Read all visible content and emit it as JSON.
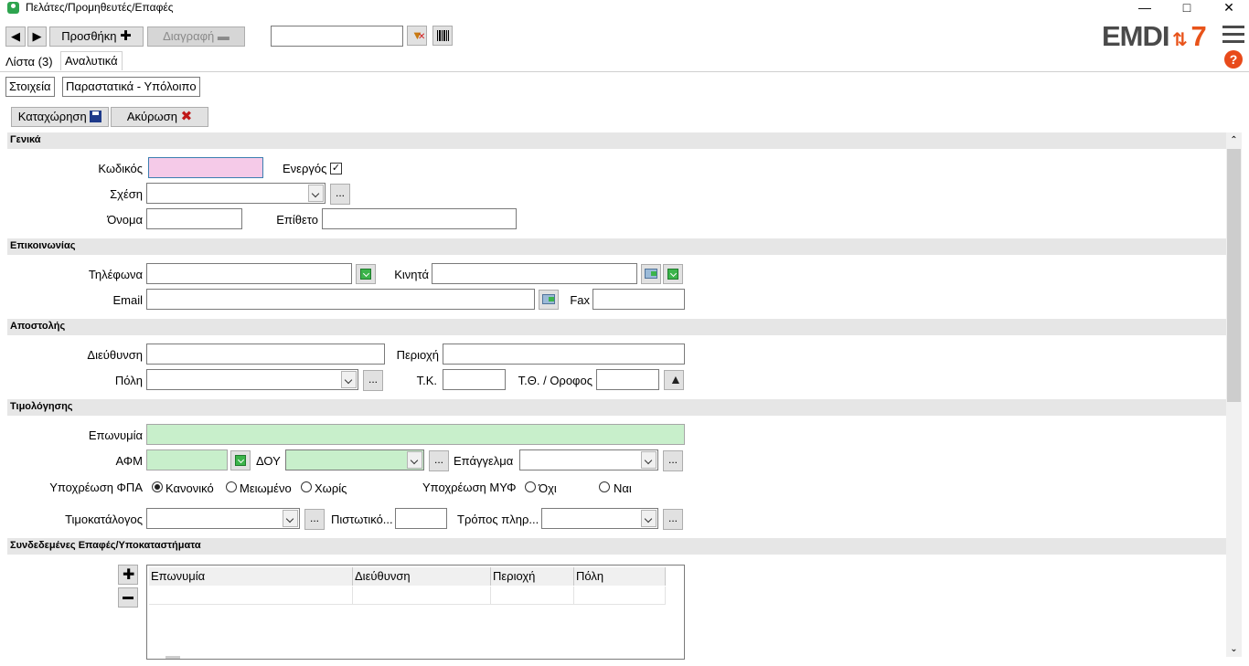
{
  "window": {
    "title": "Πελάτες/Προμηθευτές/Επαφές"
  },
  "toolbar": {
    "add_label": "Προσθήκη",
    "delete_label": "Διαγραφή",
    "search_value": "",
    "brand": "EMDI",
    "brand_suffix": "7"
  },
  "tabs": [
    {
      "label": "Λίστα (3)"
    },
    {
      "label": "Αναλυτικά"
    }
  ],
  "subtabs": [
    {
      "label": "Στοιχεία"
    },
    {
      "label": "Παραστατικά - Υπόλοιπο"
    }
  ],
  "actions": {
    "save_label": "Καταχώρηση",
    "cancel_label": "Ακύρωση"
  },
  "sections": {
    "general": "Γενικά",
    "contact": "Επικοινωνίας",
    "shipping": "Αποστολής",
    "invoicing": "Τιμολόγησης",
    "linked": "Συνδεδεμένες Επαφές/Υποκαταστήματα"
  },
  "labels": {
    "code": "Κωδικός",
    "active": "Ενεργός",
    "relation": "Σχέση",
    "name": "Όνομα",
    "surname": "Επίθετο",
    "phones": "Τηλέφωνα",
    "mobiles": "Κινητά",
    "email": "Email",
    "fax": "Fax",
    "address": "Διεύθυνση",
    "area": "Περιοχή",
    "city": "Πόλη",
    "zip": "Τ.Κ.",
    "pobox": "Τ.Θ. / Οροφος",
    "company": "Επωνυμία",
    "vat": "ΑΦΜ",
    "tax_office": "ΔΟΥ",
    "profession": "Επάγγελμα",
    "vat_obligation": "Υποχρέωση ΦΠΑ",
    "vat_normal": "Κανονικό",
    "vat_reduced": "Μειωμένο",
    "vat_none": "Χωρίς",
    "myf_obligation": "Υποχρέωση ΜΥΦ",
    "myf_no": "Όχι",
    "myf_yes": "Ναι",
    "pricelist": "Τιμοκατάλογος",
    "credit": "Πιστωτικό...",
    "payment": "Τρόπος πληρ..."
  },
  "values": {
    "code": "",
    "relation": "",
    "name": "",
    "surname": "",
    "phones": "",
    "mobiles": "",
    "email": "",
    "fax": "",
    "address": "",
    "area": "",
    "city": "",
    "zip": "",
    "pobox": "",
    "company": "",
    "vat": "",
    "tax_office": "",
    "profession": "",
    "pricelist": "",
    "credit": "",
    "payment": "",
    "active": true,
    "vat_obligation": "Κανονικό",
    "myf_obligation": ""
  },
  "grid": {
    "columns": [
      "Επωνυμία",
      "Διεύθυνση",
      "Περιοχή",
      "Πόλη"
    ]
  },
  "colors": {
    "required_code": "#f5cae8",
    "required_invoice": "#c8efcb",
    "section_bg": "#e6e6e6",
    "brand_accent": "#e8531a"
  }
}
